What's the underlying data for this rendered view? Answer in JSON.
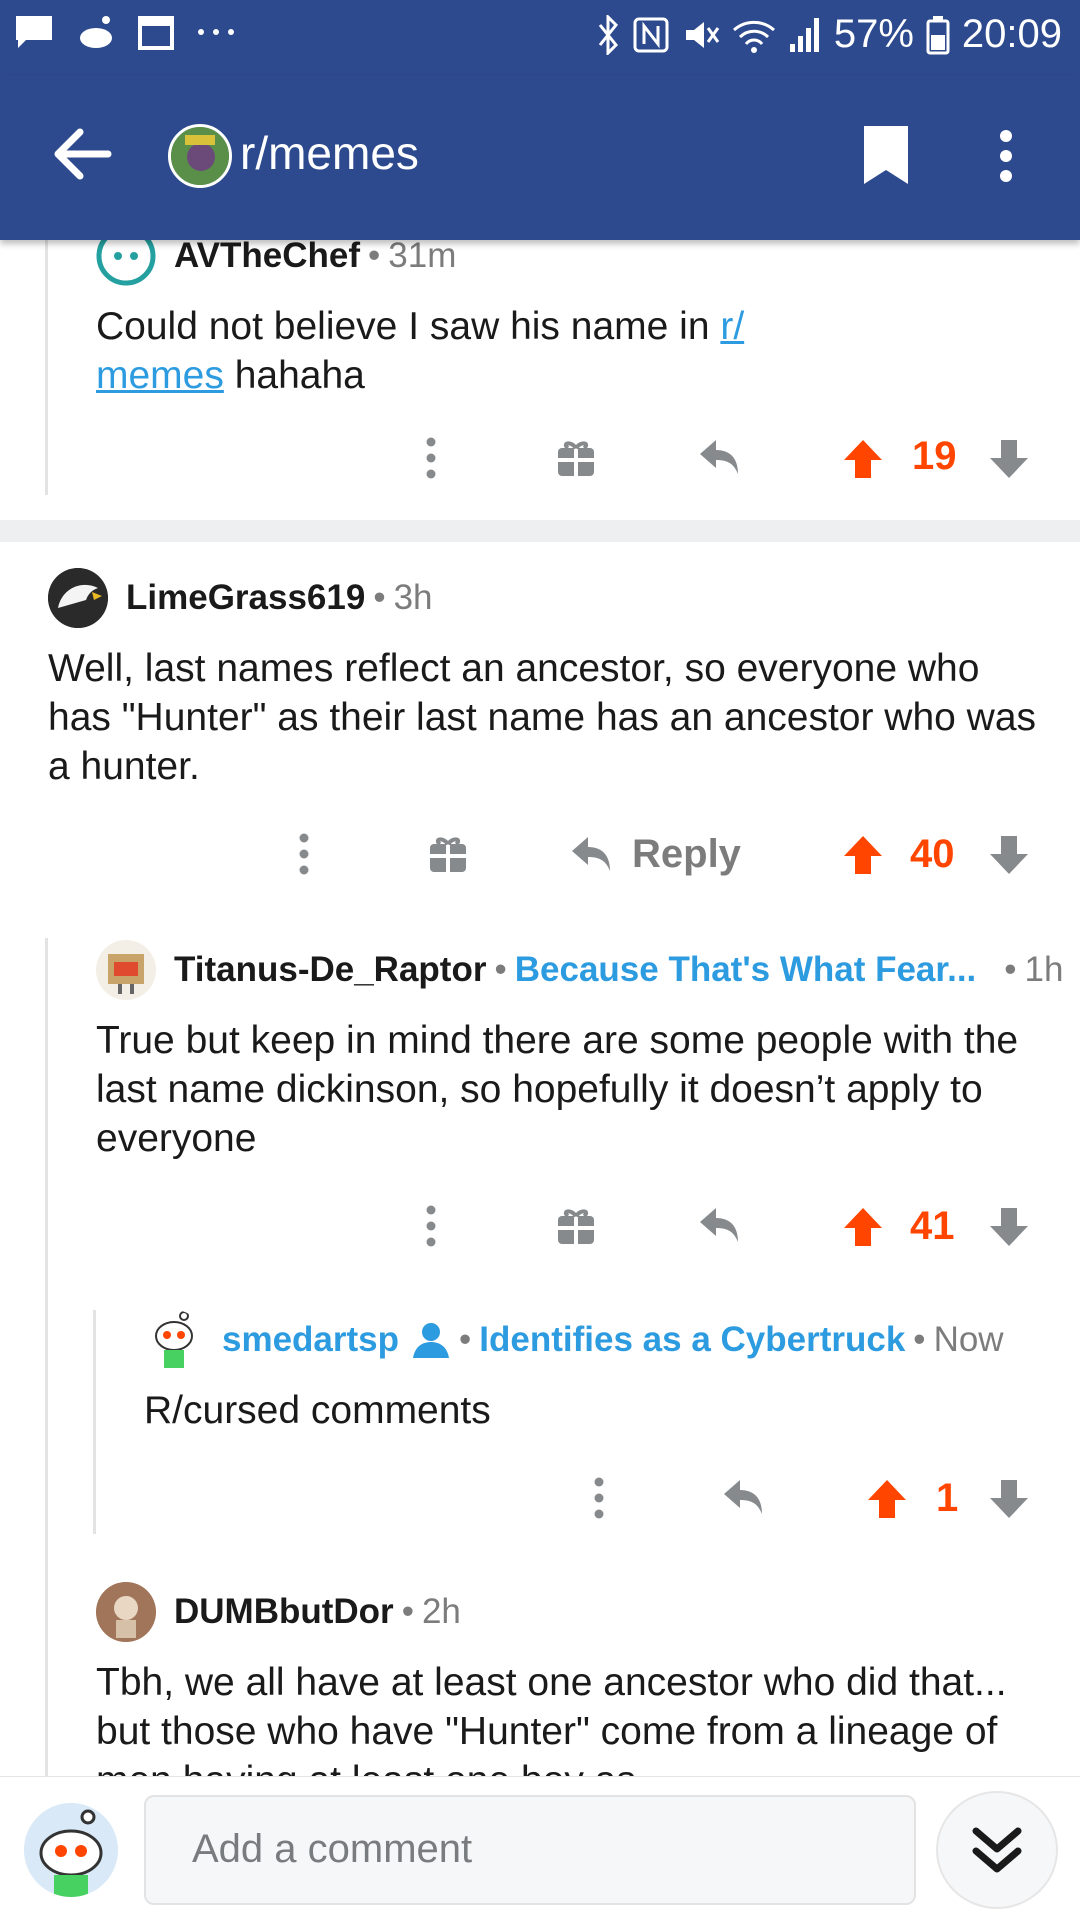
{
  "status_bar": {
    "battery": "57%",
    "time": "20:09",
    "icons": [
      "message-icon",
      "reddit-icon",
      "calendar-icon",
      "more-dots-icon",
      "bluetooth-icon",
      "nfc-icon",
      "mute-icon",
      "wifi-icon",
      "signal-icon",
      "battery-icon"
    ]
  },
  "header": {
    "subreddit": "r/memes",
    "icons": [
      "back-arrow-icon",
      "bookmark-icon",
      "overflow-menu-icon"
    ]
  },
  "comments": [
    {
      "author": "AVTheChef",
      "age": "31m",
      "body_prefix": "Could not believe I saw his name in ",
      "body_link": "r/\nmemes",
      "body_suffix": " hahaha",
      "score": "19"
    },
    {
      "author": "LimeGrass619",
      "age": "3h",
      "body": "Well, last names reflect an ancestor, so everyone who has \"Hunter\" as their last name has an ancestor who was a hunter.",
      "reply_label": "Reply",
      "score": "40"
    },
    {
      "author": "Titanus-De_Raptor",
      "flair": "Because That's What Fear...",
      "age": "1h",
      "body": "True but keep in mind there are some people with the last name dickinson, so hopefully it doesn’t apply to everyone",
      "score": "41"
    },
    {
      "author": "smedartsp",
      "flair": "Identifies as a Cybertruck",
      "age": "Now",
      "body": "R/cursed comments",
      "score": "1"
    },
    {
      "author": "DUMBbutDor",
      "age": "2h",
      "body": "Tbh, we all have at least one ancestor who did that... but those who have \"Hunter\" come from a lineage of men having at least one boy as"
    }
  ],
  "footer": {
    "placeholder": "Add a comment"
  },
  "colors": {
    "header_bg": "#2e4a8e",
    "upvote": "#ff4500",
    "flair": "#2d9be0"
  }
}
